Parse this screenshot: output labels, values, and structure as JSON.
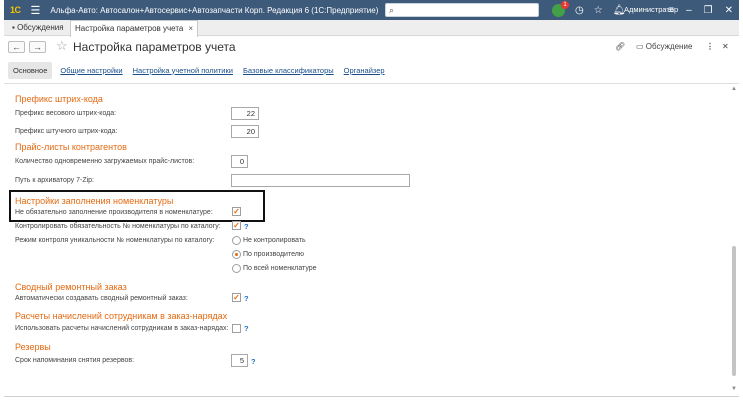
{
  "titlebar": {
    "logo": "1С",
    "app_title": "Альфа-Авто: Автосалон+Автосервис+Автозапчасти Корп. Редакция 6  (1С:Предприятие)",
    "notif_count": "1",
    "user": "Администратор"
  },
  "tabs": {
    "t1": "Обсуждения",
    "t2": "Настройка параметров учета"
  },
  "header": {
    "title": "Настройка параметров учета",
    "discussion": "Обсуждение"
  },
  "sections": [
    "Основное",
    "Общие настройки",
    "Настройка учетной политики",
    "Базовые классификаторы",
    "Органайзер"
  ],
  "barcode": {
    "group": "Префикс штрих-кода",
    "weight_label": "Префикс весового штрих-кода:",
    "weight_value": "22",
    "piece_label": "Префикс штучного штрих-кода:",
    "piece_value": "20"
  },
  "pricelists": {
    "group": "Прайс-листы контрагентов",
    "count_label": "Количество одновременно загружаемых прайс-листов:",
    "count_value": "0",
    "path_label": "Путь к архиватору 7-Zip:",
    "path_value": ""
  },
  "nomenclature": {
    "group": "Настройки заполнения номенклатуры",
    "optional_label": "Не обязательно заполнение производителя в номенклатуре:",
    "control_label": "Контролировать обязательность № номенклатуры по каталогу:",
    "q": "?",
    "uniq_label": "Режим контроля уникальности № номенклатуры по каталогу:",
    "radio": [
      "Не контролировать",
      "По производителю",
      "По всей номенклатуре"
    ]
  },
  "repair": {
    "group": "Сводный ремонтный заказ",
    "auto_label": "Автоматически создавать сводный ремонтный заказ:",
    "q": "?"
  },
  "payroll": {
    "group": "Расчеты начислений сотрудникам в заказ-нарядах",
    "use_label": "Использовать расчеты начислений сотрудникам в заказ-нарядах:",
    "q": "?"
  },
  "reserves": {
    "group": "Резервы",
    "term_label": "Срок напоминания снятия резервов:",
    "term_value": "5",
    "q": "?"
  },
  "colors": {
    "accent": "#e46a12",
    "titlebar": "#3d5a7a",
    "link": "#1a4f8b"
  }
}
